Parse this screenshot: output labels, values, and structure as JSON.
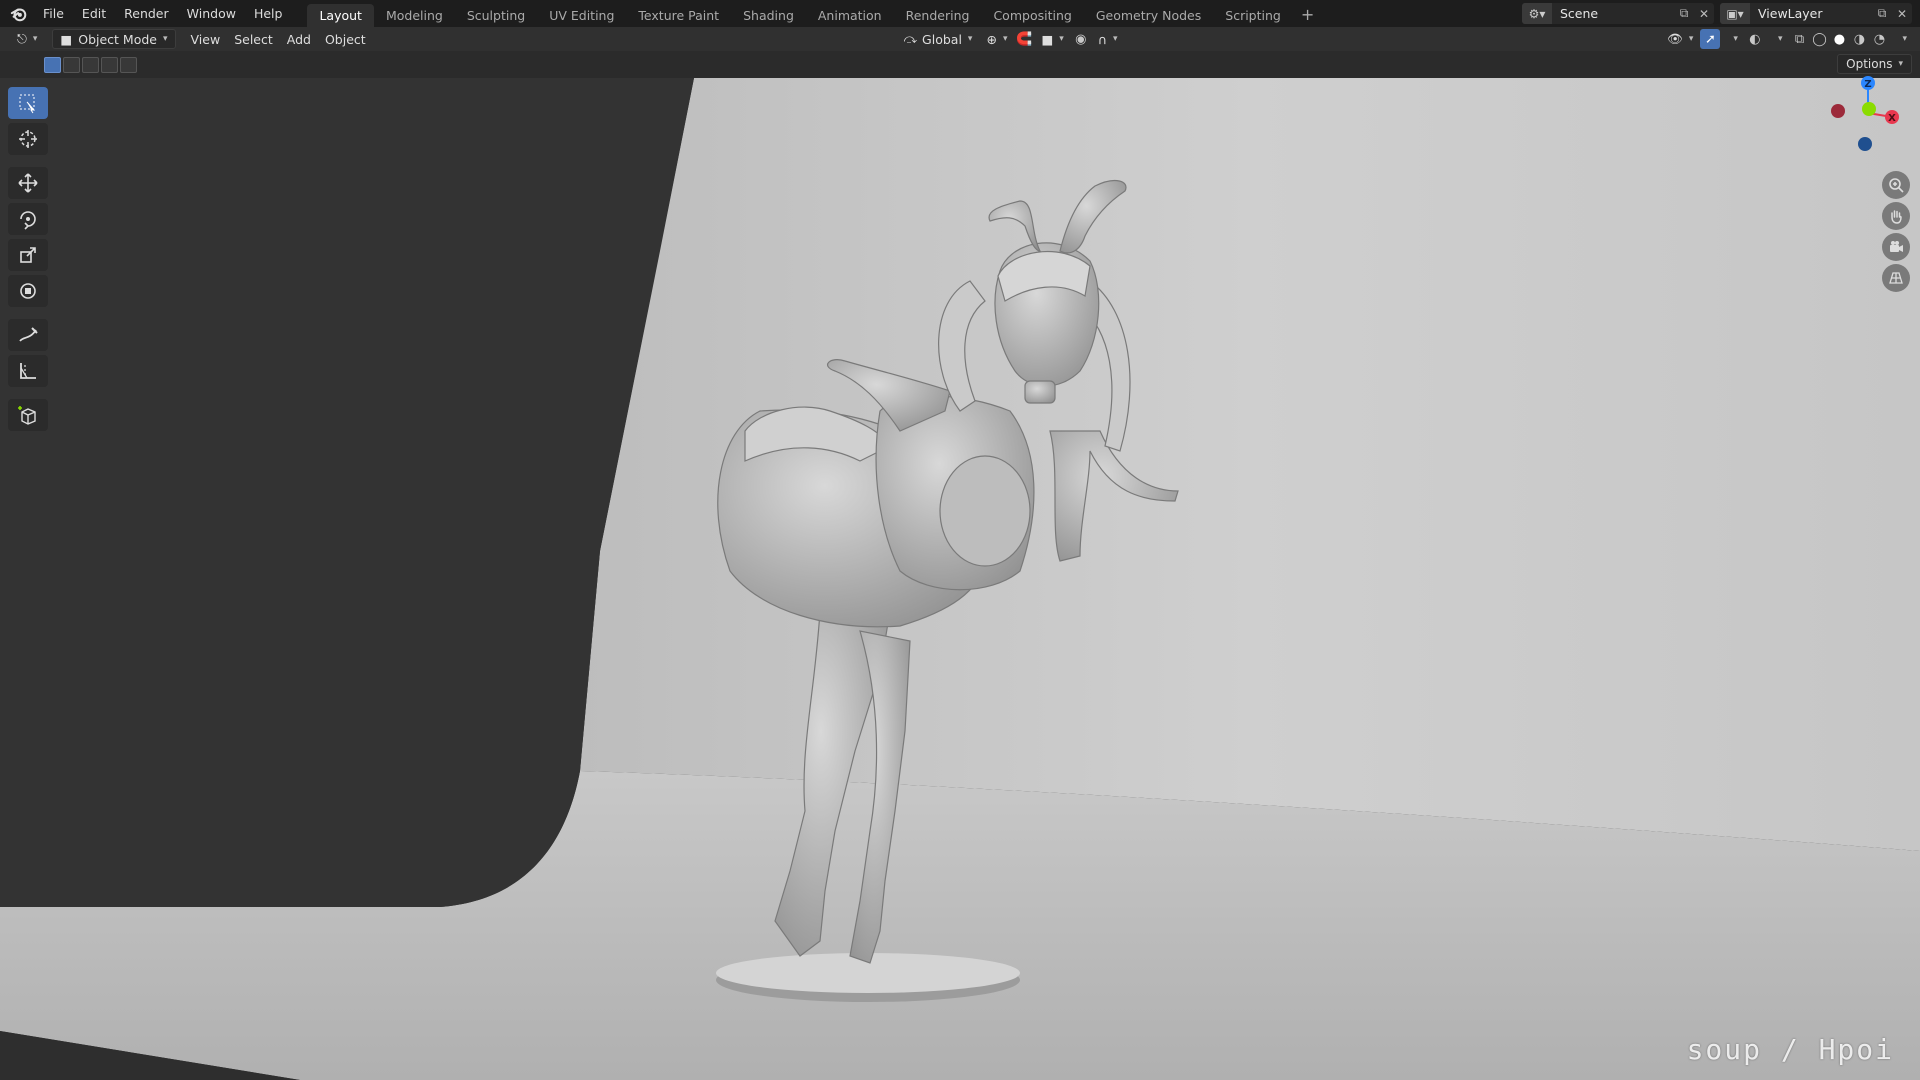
{
  "menu": [
    "File",
    "Edit",
    "Render",
    "Window",
    "Help"
  ],
  "workspaces": [
    "Layout",
    "Modeling",
    "Sculpting",
    "UV Editing",
    "Texture Paint",
    "Shading",
    "Animation",
    "Rendering",
    "Compositing",
    "Geometry Nodes",
    "Scripting"
  ],
  "active_workspace": "Layout",
  "scene": {
    "name": "Scene"
  },
  "view_layer": {
    "name": "ViewLayer"
  },
  "header": {
    "mode": "Object Mode",
    "view": "View",
    "select": "Select",
    "add": "Add",
    "object": "Object",
    "orientation": "Global"
  },
  "viewport": {
    "options": "Options",
    "gizmo_axes": {
      "z": "Z",
      "x": "X"
    }
  },
  "watermark": "soup / Hpoi",
  "colors": {
    "accent": "#4772b3",
    "axis_x": "#e8384f",
    "axis_y": "#8bdc00",
    "axis_z": "#2b87ff"
  },
  "tools": [
    "select-box-icon",
    "cursor-icon",
    "move-icon",
    "rotate-icon",
    "scale-icon",
    "transform-icon",
    "annotate-icon",
    "measure-icon",
    "add-cube-icon"
  ]
}
